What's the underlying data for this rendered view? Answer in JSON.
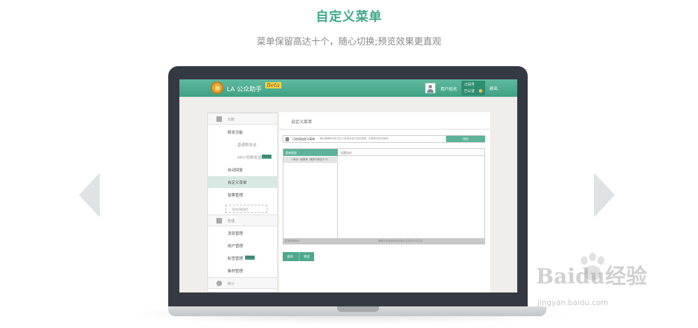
{
  "hero": {
    "title": "自定义菜单",
    "subtitle": "菜单保留高达十个，随心切换;预览效果更直观"
  },
  "colors": {
    "accent": "#3fa184",
    "title_green": "#3aa88a",
    "arrow_gray": "#dfe3e4"
  },
  "app": {
    "brand": "LA 公众助手",
    "beta": "Beta",
    "username": "用户姓名",
    "account_type": "订阅号",
    "account_status": "已认证",
    "logout": "退出"
  },
  "sidebar": {
    "sections": [
      {
        "label": "功能",
        "icon": "grid-icon"
      },
      {
        "label": "管理",
        "icon": "download-icon"
      },
      {
        "label": "统计",
        "icon": "pie-chart-icon"
      }
    ],
    "items": [
      {
        "label": "群发功能"
      },
      {
        "label": "普通群发送"
      },
      {
        "label": "48小时群发送",
        "badge": "New"
      },
      {
        "label": "自动回复"
      },
      {
        "label": "自定义菜单",
        "active": true
      },
      {
        "label": "投票管理"
      },
      {
        "label": "消息管理"
      },
      {
        "label": "用户管理"
      },
      {
        "label": "标签管理",
        "badge": "New"
      },
      {
        "label": "素材管理"
      }
    ],
    "add_feature": "添加功能插件"
  },
  "main": {
    "title": "自定义菜单",
    "lock_label": "已启用自定义菜单",
    "lock_note": "通过编辑和发布自定义菜单来进行菜单管理，如需修改请先解锁。",
    "lock_button": "停用",
    "menu_header": "菜单管理",
    "menu_add": "+添加一级菜单（最多可添加十个）",
    "menu_setting": "设置动作",
    "footer_left": "菜单设置操作",
    "footer_right": "编辑中的菜单修改后需点击发布方可生效",
    "publish": "发布",
    "preview": "预览"
  },
  "watermark": {
    "text": "Baidu经验",
    "url": "jingyan.baidu.com"
  }
}
